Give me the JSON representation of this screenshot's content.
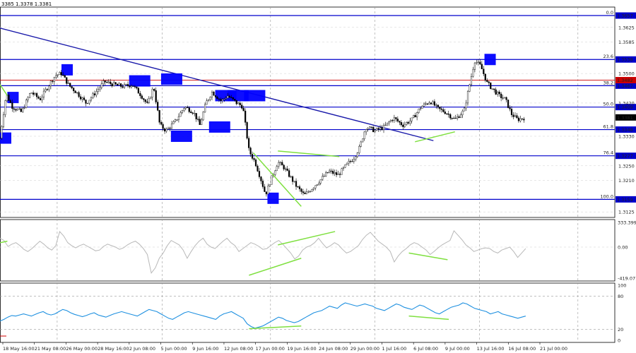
{
  "header": {
    "text": "3385 1.3378 1.3381"
  },
  "colors": {
    "level": "#0000cc",
    "red_level": "#cc0000",
    "trend": "#1a1aaa",
    "green": "#7fe040",
    "candle": "#000000",
    "cci": "#b8b8b8",
    "rsi": "#1e90e0",
    "grid": "#9a9a9a",
    "box": "#0000ff"
  },
  "chart_data": [
    {
      "type": "candlestick",
      "ylim": [
        1.311,
        1.368
      ],
      "y_ticks": [
        "1.3625",
        "1.3585",
        "1.3500",
        "1.3420",
        "1.3330",
        "1.3250",
        "1.3210",
        "1.3125"
      ],
      "x_labels": [
        "18 May 16:00",
        "21 May 08:00",
        "26 May 00:00",
        "28 May 16:00",
        "2 Jun 08:00",
        "5 Jun 00:00",
        "9 Jun 16:00",
        "12 Jun 08:00",
        "17 Jun 00:00",
        "19 Jun 16:00",
        "24 Jun 08:00",
        "29 Jun 00:00",
        "1 Jul 16:00",
        "6 Jul 08:00",
        "9 Jul 00:00",
        "13 Jul 16:00",
        "16 Jul 08:00",
        "21 Jul 00:00"
      ],
      "fib_levels": [
        {
          "fib": "0.0",
          "price": 1.3657,
          "label": "1.3657"
        },
        {
          "fib": "23.6",
          "price": 1.3538,
          "label": "1.3538"
        },
        {
          "fib": "38.2",
          "price": 1.3467,
          "label": "1.3467"
        },
        {
          "fib": "50.0",
          "price": 1.3409,
          "label": "1.3409"
        },
        {
          "fib": "61.8",
          "price": 1.3348,
          "label": "1.3348"
        },
        {
          "fib": "76.4",
          "price": 1.3277,
          "label": "1.3277"
        },
        {
          "fib": "100.0",
          "price": 1.3159,
          "label": "1.3159"
        }
      ],
      "red_level": {
        "price": 1.3482,
        "label": "1.3482"
      },
      "current_price": {
        "price": 1.3381,
        "label": "1.3381"
      },
      "trend_line": [
        [
          0,
          1.3623
        ],
        [
          0.705,
          1.3318
        ]
      ],
      "close_path": [
        [
          0,
          1.3325
        ],
        [
          0.01,
          1.3445
        ],
        [
          0.02,
          1.341
        ],
        [
          0.035,
          1.3395
        ],
        [
          0.05,
          1.345
        ],
        [
          0.065,
          1.343
        ],
        [
          0.08,
          1.347
        ],
        [
          0.09,
          1.3495
        ],
        [
          0.1,
          1.35
        ],
        [
          0.112,
          1.3468
        ],
        [
          0.125,
          1.3448
        ],
        [
          0.14,
          1.342
        ],
        [
          0.155,
          1.3448
        ],
        [
          0.17,
          1.3478
        ],
        [
          0.185,
          1.347
        ],
        [
          0.2,
          1.3465
        ],
        [
          0.215,
          1.347
        ],
        [
          0.23,
          1.344
        ],
        [
          0.24,
          1.3415
        ],
        [
          0.25,
          1.3465
        ],
        [
          0.26,
          1.336
        ],
        [
          0.27,
          1.3345
        ],
        [
          0.285,
          1.337
        ],
        [
          0.3,
          1.341
        ],
        [
          0.315,
          1.3395
        ],
        [
          0.325,
          1.336
        ],
        [
          0.335,
          1.342
        ],
        [
          0.345,
          1.345
        ],
        [
          0.36,
          1.3425
        ],
        [
          0.37,
          1.344
        ],
        [
          0.385,
          1.342
        ],
        [
          0.395,
          1.341
        ],
        [
          0.405,
          1.329
        ],
        [
          0.415,
          1.326
        ],
        [
          0.425,
          1.321
        ],
        [
          0.432,
          1.3172
        ],
        [
          0.44,
          1.321
        ],
        [
          0.452,
          1.326
        ],
        [
          0.462,
          1.3245
        ],
        [
          0.472,
          1.322
        ],
        [
          0.482,
          1.3195
        ],
        [
          0.495,
          1.317
        ],
        [
          0.508,
          1.319
        ],
        [
          0.52,
          1.321
        ],
        [
          0.535,
          1.3235
        ],
        [
          0.55,
          1.3225
        ],
        [
          0.565,
          1.3255
        ],
        [
          0.575,
          1.327
        ],
        [
          0.585,
          1.33
        ],
        [
          0.595,
          1.3355
        ],
        [
          0.61,
          1.3345
        ],
        [
          0.625,
          1.3355
        ],
        [
          0.64,
          1.338
        ],
        [
          0.655,
          1.336
        ],
        [
          0.67,
          1.3375
        ],
        [
          0.685,
          1.341
        ],
        [
          0.7,
          1.3425
        ],
        [
          0.712,
          1.3405
        ],
        [
          0.725,
          1.3395
        ],
        [
          0.74,
          1.3375
        ],
        [
          0.755,
          1.34
        ],
        [
          0.765,
          1.348
        ],
        [
          0.772,
          1.3535
        ],
        [
          0.782,
          1.352
        ],
        [
          0.792,
          1.3475
        ],
        [
          0.8,
          1.346
        ],
        [
          0.812,
          1.344
        ],
        [
          0.822,
          1.343
        ],
        [
          0.832,
          1.339
        ],
        [
          0.842,
          1.3375
        ],
        [
          0.855,
          1.3381
        ]
      ],
      "boxes": [
        [
          0.0,
          1.3325
        ],
        [
          0.012,
          1.3435
        ],
        [
          0.1,
          1.351
        ],
        [
          0.21,
          1.348
        ],
        [
          0.262,
          1.3485
        ],
        [
          0.278,
          1.333
        ],
        [
          0.34,
          1.3355
        ],
        [
          0.35,
          1.344
        ],
        [
          0.37,
          1.344
        ],
        [
          0.397,
          1.344
        ],
        [
          0.435,
          1.3162
        ],
        [
          0.788,
          1.3538
        ]
      ],
      "green_lines": [
        [
          [
            0.0,
            1.347
          ],
          [
            0.012,
            1.344
          ]
        ],
        [
          [
            0.412,
            1.3285
          ],
          [
            0.49,
            1.314
          ]
        ],
        [
          [
            0.452,
            1.329
          ],
          [
            0.552,
            1.3275
          ]
        ],
        [
          [
            0.675,
            1.3315
          ],
          [
            0.74,
            1.3342
          ]
        ]
      ]
    },
    {
      "type": "line",
      "name": "",
      "ylim": [
        -419.071,
        333.3997
      ],
      "y_ticks": [
        "333.3997",
        "0.00",
        "-419.071"
      ],
      "series": [
        {
          "values": [
            120,
            90,
            10,
            40,
            60,
            20,
            -30,
            -60,
            -20,
            30,
            80,
            40,
            -10,
            -40,
            20,
            210,
            150,
            60,
            20,
            -10,
            20,
            40,
            10,
            -20,
            -50,
            -40,
            10,
            40,
            20,
            0,
            -30,
            -10,
            30,
            60,
            80,
            40,
            -20,
            -100,
            -350,
            -280,
            -150,
            -80,
            20,
            90,
            60,
            30,
            -40,
            -150,
            -60,
            20,
            80,
            120,
            40,
            0,
            -20,
            30,
            80,
            120,
            60,
            20,
            -60,
            -20,
            20,
            60,
            40,
            10,
            -30,
            -20,
            20,
            60,
            90,
            40,
            -20,
            -80,
            -160,
            -120,
            -40,
            0,
            20,
            60,
            120,
            50,
            -10,
            20,
            60,
            30,
            -30,
            -80,
            -60,
            -20,
            20,
            100,
            160,
            200,
            140,
            80,
            40,
            0,
            -60,
            -200,
            -120,
            -60,
            -20,
            30,
            60,
            40,
            0,
            -40,
            -100,
            -60,
            -10,
            30,
            60,
            90,
            220,
            160,
            100,
            30,
            -10,
            -60,
            -40,
            -20,
            -10,
            -20,
            -60,
            -80,
            -40,
            -20,
            0,
            -60,
            -140,
            -80,
            -20
          ]
        }
      ],
      "green_lines": [
        [
          [
            0.0,
            60
          ],
          [
            0.012,
            80
          ]
        ],
        [
          [
            0.405,
            -380
          ],
          [
            0.49,
            -150
          ]
        ],
        [
          [
            0.452,
            30
          ],
          [
            0.545,
            210
          ]
        ],
        [
          [
            0.665,
            -80
          ],
          [
            0.728,
            -170
          ]
        ]
      ]
    },
    {
      "type": "line",
      "name": "",
      "ylim": [
        0,
        100
      ],
      "y_ticks": [
        "100",
        "80",
        "20",
        "0"
      ],
      "series": [
        {
          "values": [
            35,
            38,
            42,
            45,
            44,
            46,
            48,
            46,
            44,
            47,
            50,
            52,
            48,
            46,
            48,
            52,
            56,
            54,
            50,
            47,
            45,
            43,
            45,
            48,
            50,
            46,
            44,
            42,
            45,
            48,
            50,
            52,
            50,
            48,
            46,
            44,
            48,
            52,
            56,
            54,
            52,
            48,
            44,
            40,
            38,
            42,
            46,
            50,
            52,
            50,
            48,
            46,
            44,
            42,
            40,
            38,
            44,
            48,
            50,
            52,
            48,
            44,
            40,
            30,
            25,
            22,
            24,
            26,
            30,
            34,
            38,
            42,
            40,
            36,
            34,
            32,
            34,
            38,
            42,
            46,
            50,
            52,
            54,
            58,
            62,
            60,
            58,
            64,
            68,
            66,
            64,
            62,
            64,
            66,
            64,
            62,
            58,
            56,
            54,
            58,
            62,
            66,
            64,
            60,
            58,
            56,
            60,
            64,
            62,
            58,
            54,
            50,
            48,
            52,
            56,
            60,
            62,
            64,
            68,
            66,
            62,
            58,
            56,
            54,
            52,
            48,
            50,
            52,
            48,
            46,
            44,
            42,
            40,
            42,
            44
          ]
        }
      ],
      "green_lines": [
        [
          [
            0.405,
            21
          ],
          [
            0.49,
            26
          ]
        ],
        [
          [
            0.665,
            44
          ],
          [
            0.73,
            38
          ]
        ]
      ]
    }
  ]
}
